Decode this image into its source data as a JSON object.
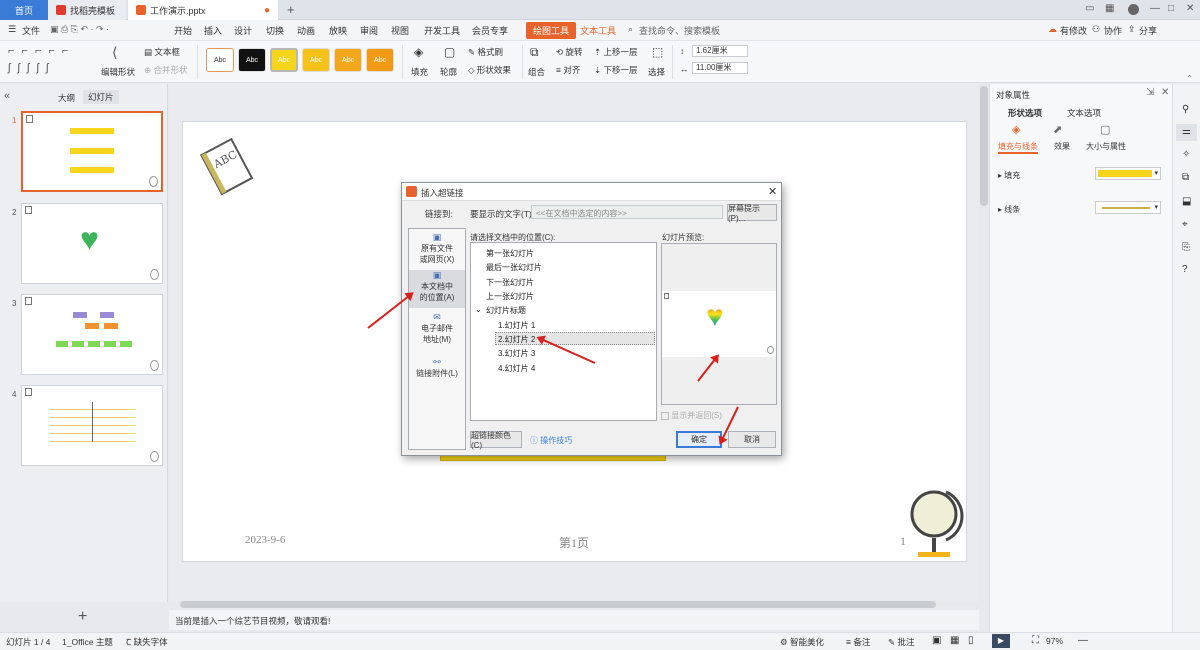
{
  "titlebar": {
    "tab_home": "首页",
    "tab_template": "找稻壳模板",
    "tab_doc": "工作演示.pptx",
    "new_tab": "+"
  },
  "menubar": {
    "file": "文件",
    "items": [
      "开始",
      "插入",
      "设计",
      "切换",
      "动画",
      "放映",
      "审阅",
      "视图",
      "开发工具",
      "会员专享"
    ],
    "drawing_tools": "绘图工具",
    "text_tools": "文本工具",
    "search": "查找命令、搜索模板",
    "modified": "有修改",
    "collab": "协作",
    "share": "分享"
  },
  "toolbar": {
    "edit_shape": "编辑形状",
    "text_box": "文本框",
    "merge_shape": "合并形状",
    "swatch_label": "Abc",
    "fill": "填充",
    "outline": "轮廓",
    "format_brush": "格式刷",
    "shape_effect": "形状效果",
    "group": "组合",
    "rotate": "旋转",
    "align": "对齐",
    "bring_forward": "上移一层",
    "send_backward": "下移一层",
    "select": "选择",
    "width": "1.62厘米",
    "height": "11.00厘米"
  },
  "leftpanel": {
    "tab_outline": "大纲",
    "tab_slides": "幻灯片",
    "slide_nums": [
      "1",
      "2",
      "3",
      "4"
    ],
    "add": "+"
  },
  "slide": {
    "date": "2023-9-6",
    "page": "第1页",
    "page_num": "1",
    "abc_text": "ABC"
  },
  "notes": "当前是插入一个综艺节目视频，敬请观看!",
  "statusbar": {
    "slide_count": "幻灯片 1 / 4",
    "theme": "1_Office 主题",
    "missing_font": "缺失字体",
    "beautify": "智能美化",
    "notes": "备注",
    "comment": "批注",
    "zoom": "97%"
  },
  "rightpane": {
    "title": "对象属性",
    "tab_shape": "形状选项",
    "tab_text": "文本选项",
    "sub_fill_line": "填充与线条",
    "sub_effect": "效果",
    "sub_size": "大小与属性",
    "fill": "填充",
    "line": "线条",
    "fill_color": "#f7d51a",
    "line_color": "#c9b04a"
  },
  "dialog": {
    "title": "插入超链接",
    "link_to": "链接到:",
    "display_text_label": "要显示的文字(T):",
    "display_text_value": "<<在文档中选定的内容>>",
    "screen_tip": "屏幕提示(P)...",
    "nav": [
      {
        "l1": "原有文件",
        "l2": "或网页(X)"
      },
      {
        "l1": "本文档中",
        "l2": "的位置(A)"
      },
      {
        "l1": "电子邮件",
        "l2": "地址(M)"
      },
      {
        "l1": "链接附件(L)",
        "l2": ""
      }
    ],
    "pos_label": "请选择文档中的位置(C):",
    "positions": [
      "第一张幻灯片",
      "最后一张幻灯片",
      "下一张幻灯片",
      "上一张幻灯片"
    ],
    "titles_header": "幻灯片标题",
    "titles": [
      "1.幻灯片 1",
      "2.幻灯片 2",
      "3.幻灯片 3",
      "4.幻灯片 4"
    ],
    "preview_label": "幻灯片预览:",
    "show_return": "显示并返回(S)",
    "link_color": "超链接颜色(C)",
    "tips": "操作技巧",
    "ok": "确定",
    "cancel": "取消"
  }
}
